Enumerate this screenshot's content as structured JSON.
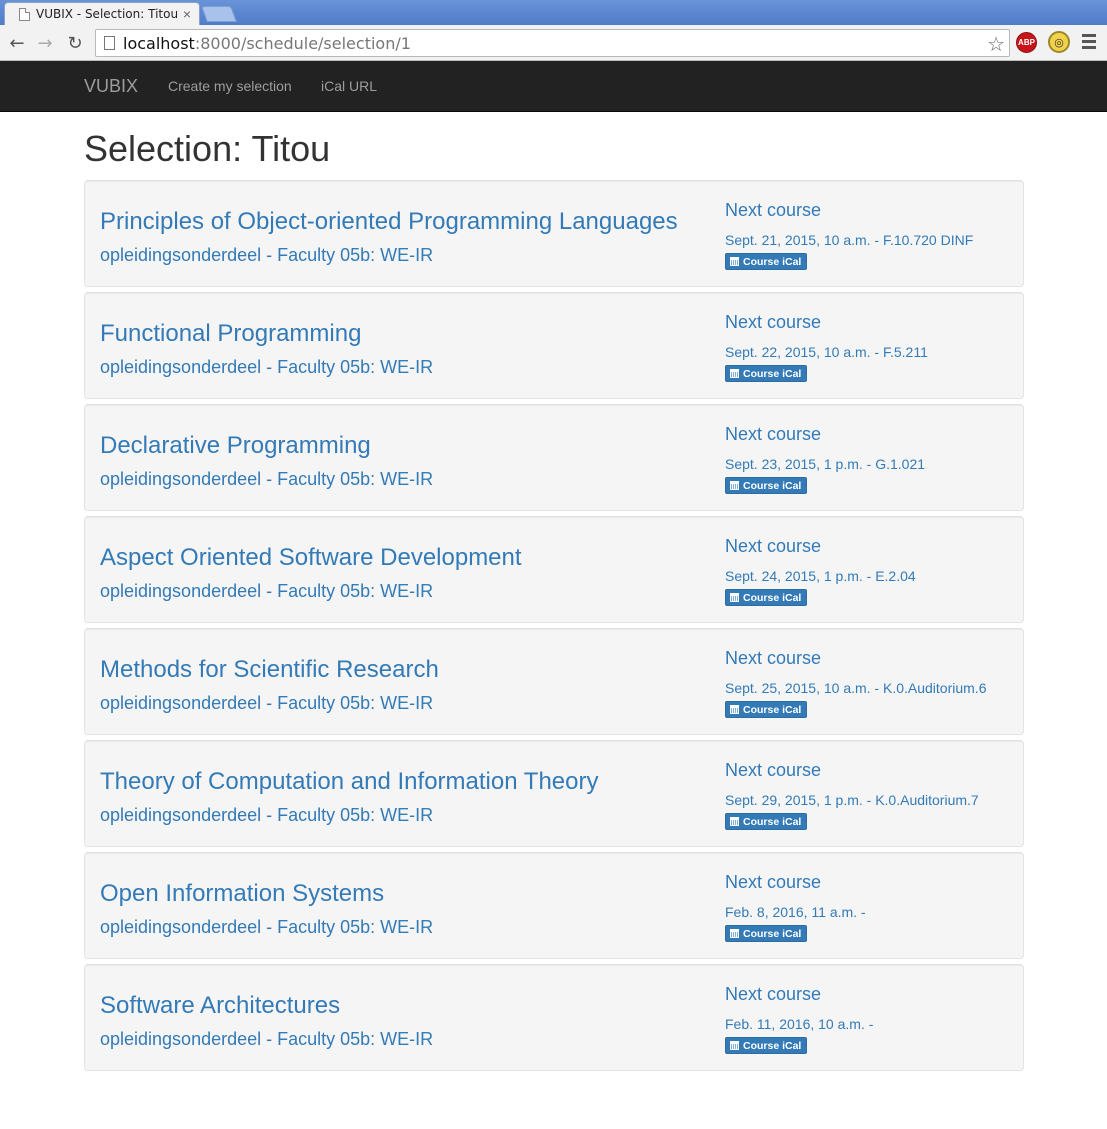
{
  "browser": {
    "tab_title": "VUBIX - Selection: Titou",
    "url_host": "localhost",
    "url_rest": ":8000/schedule/selection/1",
    "abp_label": "ABP"
  },
  "navbar": {
    "brand": "VUBIX",
    "links": [
      "Create my selection",
      "iCal URL"
    ]
  },
  "page": {
    "title": "Selection: Titou"
  },
  "courses": [
    {
      "name": "Principles of Object-oriented Programming Languages",
      "subtitle": "opleidingsonderdeel - Faculty 05b: WE-IR",
      "next_label": "Next course",
      "next_date": "Sept. 21, 2015, 10 a.m. - F.10.720 DINF",
      "ical_label": "Course iCal"
    },
    {
      "name": "Functional Programming",
      "subtitle": "opleidingsonderdeel - Faculty 05b: WE-IR",
      "next_label": "Next course",
      "next_date": "Sept. 22, 2015, 10 a.m. - F.5.211",
      "ical_label": "Course iCal"
    },
    {
      "name": "Declarative Programming",
      "subtitle": "opleidingsonderdeel - Faculty 05b: WE-IR",
      "next_label": "Next course",
      "next_date": "Sept. 23, 2015, 1 p.m. - G.1.021",
      "ical_label": "Course iCal"
    },
    {
      "name": "Aspect Oriented Software Development",
      "subtitle": "opleidingsonderdeel - Faculty 05b: WE-IR",
      "next_label": "Next course",
      "next_date": "Sept. 24, 2015, 1 p.m. - E.2.04",
      "ical_label": "Course iCal"
    },
    {
      "name": "Methods for Scientific Research",
      "subtitle": "opleidingsonderdeel - Faculty 05b: WE-IR",
      "next_label": "Next course",
      "next_date": "Sept. 25, 2015, 10 a.m. - K.0.Auditorium.6",
      "ical_label": "Course iCal"
    },
    {
      "name": "Theory of Computation and Information Theory",
      "subtitle": "opleidingsonderdeel - Faculty 05b: WE-IR",
      "next_label": "Next course",
      "next_date": "Sept. 29, 2015, 1 p.m. - K.0.Auditorium.7",
      "ical_label": "Course iCal"
    },
    {
      "name": "Open Information Systems",
      "subtitle": "opleidingsonderdeel - Faculty 05b: WE-IR",
      "next_label": "Next course",
      "next_date": "Feb. 8, 2016, 11 a.m. -",
      "ical_label": "Course iCal"
    },
    {
      "name": "Software Architectures",
      "subtitle": "opleidingsonderdeel - Faculty 05b: WE-IR",
      "next_label": "Next course",
      "next_date": "Feb. 11, 2016, 10 a.m. -",
      "ical_label": "Course iCal"
    }
  ],
  "colors": {
    "link": "#337ab7",
    "navbar": "#222222",
    "well": "#f5f5f5"
  }
}
